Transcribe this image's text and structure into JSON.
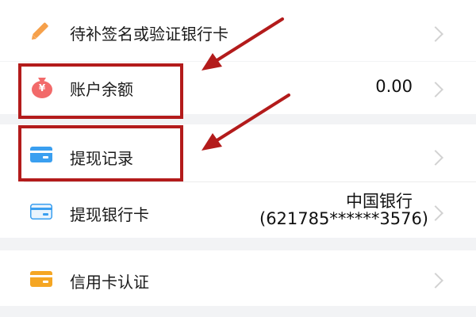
{
  "menu": {
    "items": [
      {
        "label": "待补签名或验证银行卡",
        "icon": "pencil-icon"
      },
      {
        "label": "账户余额",
        "icon": "money-bag-icon",
        "value": "0.00"
      },
      {
        "label": "提现记录",
        "icon": "card-icon"
      },
      {
        "label": "提现银行卡",
        "icon": "card-icon",
        "value_line1": "中国银行",
        "value_line2": "(621785******3576)"
      },
      {
        "label": "信用卡认证",
        "icon": "credit-card-icon"
      }
    ],
    "bag_symbol": "¥"
  },
  "colors": {
    "highlight": "#b31b1b",
    "pencil": "#f6a04a",
    "bag": "#f26a6a",
    "card_blue": "#3a9ff0",
    "card_orange": "#f5a623"
  }
}
